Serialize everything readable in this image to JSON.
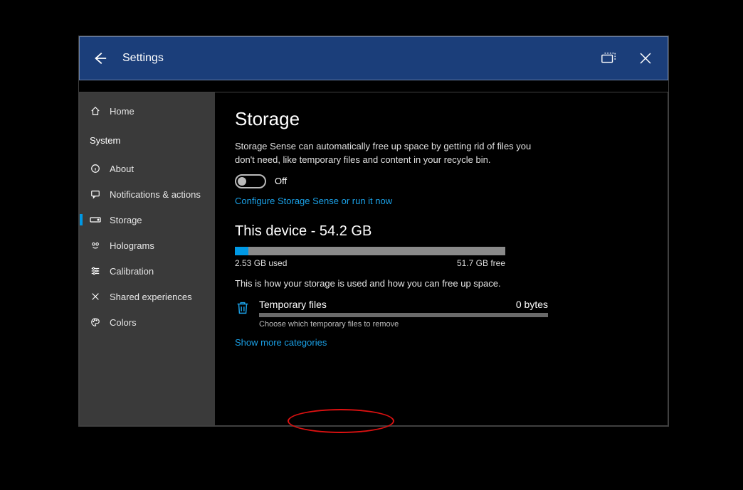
{
  "titlebar": {
    "title": "Settings"
  },
  "sidebar": {
    "home": "Home",
    "section": "System",
    "items": [
      {
        "label": "About",
        "icon": "info"
      },
      {
        "label": "Notifications & actions",
        "icon": "message"
      },
      {
        "label": "Storage",
        "icon": "drive",
        "active": true
      },
      {
        "label": "Holograms",
        "icon": "hologram"
      },
      {
        "label": "Calibration",
        "icon": "sliders"
      },
      {
        "label": "Shared experiences",
        "icon": "share"
      },
      {
        "label": "Colors",
        "icon": "palette"
      }
    ]
  },
  "main": {
    "heading": "Storage",
    "description": "Storage Sense can automatically free up space by getting rid of files you don't need, like temporary files and content in your recycle bin.",
    "toggle_state": "Off",
    "configure_link": "Configure Storage Sense or run it now",
    "device_heading": "This device - 54.2 GB",
    "used_label": "2.53 GB used",
    "free_label": "51.7 GB free",
    "used_percent": 5,
    "usage_desc": "This is how your storage is used and how you can free up space.",
    "category": {
      "name": "Temporary files",
      "value": "0 bytes",
      "sub": "Choose which temporary files to remove"
    },
    "show_more": "Show more categories"
  }
}
